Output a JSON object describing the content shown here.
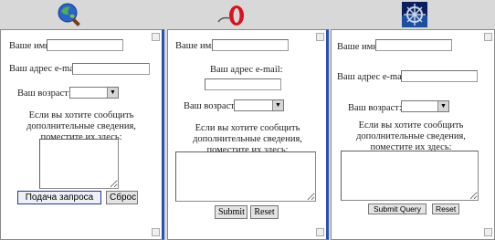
{
  "browsers": [
    "ie",
    "opera",
    "netscape"
  ],
  "ie": {
    "name_label": "Ваше имя",
    "email_label": "Ваш адрес e-mail:",
    "age_label": "Ваш возраст:",
    "comment_label": "Если вы хотите сообщить дополнительные сведения, поместите их здесь:",
    "submit": "Подача запроса",
    "reset": "Сброс"
  },
  "opera": {
    "name_label": "Ваше имя",
    "email_label": "Ваш адрес e-mail:",
    "age_label": "Ваш возраст:",
    "comment_label": "Если вы хотите сообщить дополнительные сведения, поместите их здесь:",
    "submit": "Submit",
    "reset": "Reset"
  },
  "netscape": {
    "name_label": "Ваше имя",
    "email_label": "Ваш адрес e-mail:",
    "age_label": "Ваш возраст:",
    "comment_label": "Если вы хотите сообщить дополнительные сведения, поместите их здесь:",
    "submit": "Submit Query",
    "reset": "Reset"
  },
  "colors": {
    "panel_divider": "#2b4fb8",
    "background": "#d8d8d8"
  },
  "icons": {
    "ie": "internet-explorer-icon",
    "opera": "opera-icon",
    "netscape": "netscape-icon"
  }
}
